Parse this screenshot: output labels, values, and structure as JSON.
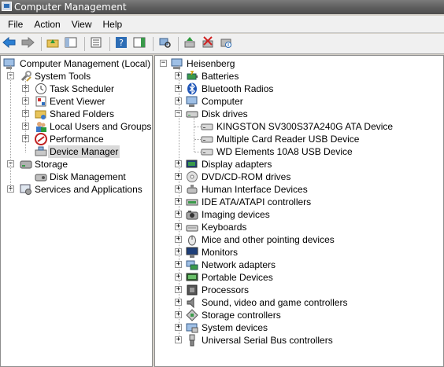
{
  "window": {
    "title": "Computer Management"
  },
  "menu": [
    "File",
    "Action",
    "View",
    "Help"
  ],
  "toolbar": [
    {
      "name": "back-icon"
    },
    {
      "name": "forward-icon"
    },
    {
      "sep": true
    },
    {
      "name": "up-folder-icon"
    },
    {
      "name": "show-hide-tree-icon"
    },
    {
      "sep": true
    },
    {
      "name": "properties-icon"
    },
    {
      "sep": true
    },
    {
      "name": "help-icon"
    },
    {
      "name": "show-action-pane-icon"
    },
    {
      "sep": true
    },
    {
      "name": "scan-hardware-icon"
    },
    {
      "sep": true
    },
    {
      "name": "update-driver-icon"
    },
    {
      "name": "uninstall-device-icon"
    },
    {
      "name": "disable-device-icon"
    }
  ],
  "left_tree": {
    "root": "Computer Management (Local)",
    "system_tools": "System Tools",
    "system_children": [
      "Task Scheduler",
      "Event Viewer",
      "Shared Folders",
      "Local Users and Groups",
      "Performance",
      "Device Manager"
    ],
    "storage": "Storage",
    "disk_management": "Disk Management",
    "services": "Services and Applications"
  },
  "right_tree": {
    "root": "Heisenberg",
    "categories_before": [
      "Batteries",
      "Bluetooth Radios",
      "Computer"
    ],
    "disk_drives": "Disk drives",
    "disk_devices": [
      "KINGSTON SV300S37A240G ATA Device",
      "Multiple Card  Reader USB Device",
      "WD Elements 10A8 USB Device"
    ],
    "categories_after": [
      "Display adapters",
      "DVD/CD-ROM drives",
      "Human Interface Devices",
      "IDE ATA/ATAPI controllers",
      "Imaging devices",
      "Keyboards",
      "Mice and other pointing devices",
      "Monitors",
      "Network adapters",
      "Portable Devices",
      "Processors",
      "Sound, video and game controllers",
      "Storage controllers",
      "System devices",
      "Universal Serial Bus controllers"
    ]
  },
  "colors": {
    "titlebar": "#5f5f5f",
    "selection": "#d9d9d9",
    "accent": "#2d6db5"
  }
}
